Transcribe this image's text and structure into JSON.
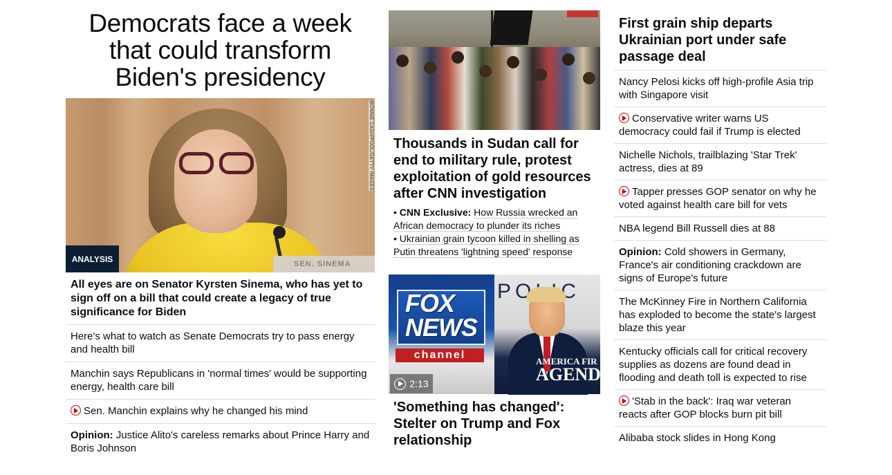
{
  "left": {
    "headline": "Democrats face a week that could transform Biden's presidency",
    "photo_credit": "BONNIE CASH/POOL/GETTY IMAGES",
    "nameplate": "SEN. SINEMA",
    "badge": "ANALYSIS",
    "lead": "All eyes are on Senator Kyrsten Sinema, who has yet to sign off on a bill that could create a legacy of true significance for Biden",
    "items": [
      {
        "text": "Here's what to watch as Senate Democrats try to pass energy and health bill"
      },
      {
        "text": "Manchin says Republicans in 'normal times' would be supporting energy, health care bill"
      },
      {
        "text": "Sen. Manchin explains why he changed his mind",
        "video": true
      },
      {
        "prefix": "Opinion:",
        "text": "Justice Alito's careless remarks about Prince Harry and Boris Johnson"
      }
    ]
  },
  "middle": {
    "headline": "Thousands in Sudan call for end to military rule, protest exploitation of gold resources after CNN investigation",
    "bullets": [
      {
        "marker": "•",
        "prefix": "CNN Exclusive:",
        "text": "How Russia wrecked an African democracy to plunder its riches"
      },
      {
        "marker": "•",
        "text": "Ukrainian grain tycoon killed in shelling as Putin threatens 'lightning speed' response"
      }
    ],
    "video": {
      "fox_logo": "FOX NEWS",
      "fox_channel": "channel",
      "podium": "POLIC",
      "agenda_line1": "AMERICA FIR",
      "agenda_line2": "AGEND",
      "duration": "2:13"
    },
    "headline2": "'Something has changed': Stelter on Trump and Fox relationship"
  },
  "right": {
    "headline": "First grain ship departs Ukrainian port under safe passage deal",
    "items": [
      {
        "text": "Nancy Pelosi kicks off high-profile Asia trip with Singapore visit"
      },
      {
        "text": "Conservative writer warns US democracy could fail if Trump is elected",
        "video": true
      },
      {
        "text": "Nichelle Nichols, trailblazing 'Star Trek' actress, dies at 89"
      },
      {
        "text": "Tapper presses GOP senator on why he voted against health care bill for vets",
        "video": true
      },
      {
        "text": "NBA legend Bill Russell dies at 88"
      },
      {
        "prefix": "Opinion:",
        "text": "Cold showers in Germany, France's air conditioning crackdown are signs of Europe's future"
      },
      {
        "text": "The McKinney Fire in Northern California has exploded to become the state's largest blaze this year"
      },
      {
        "text": "Kentucky officials call for critical recovery supplies as dozens are found dead in flooding and death toll is expected to rise"
      },
      {
        "text": "'Stab in the back': Iraq war veteran reacts after GOP blocks burn pit bill",
        "video": true
      },
      {
        "text": "Alibaba stock slides in Hong Kong"
      }
    ]
  },
  "colors": {
    "video_red": "#cc0000",
    "badge_navy": "#0c1e33",
    "divider": "#dcdcdc"
  }
}
